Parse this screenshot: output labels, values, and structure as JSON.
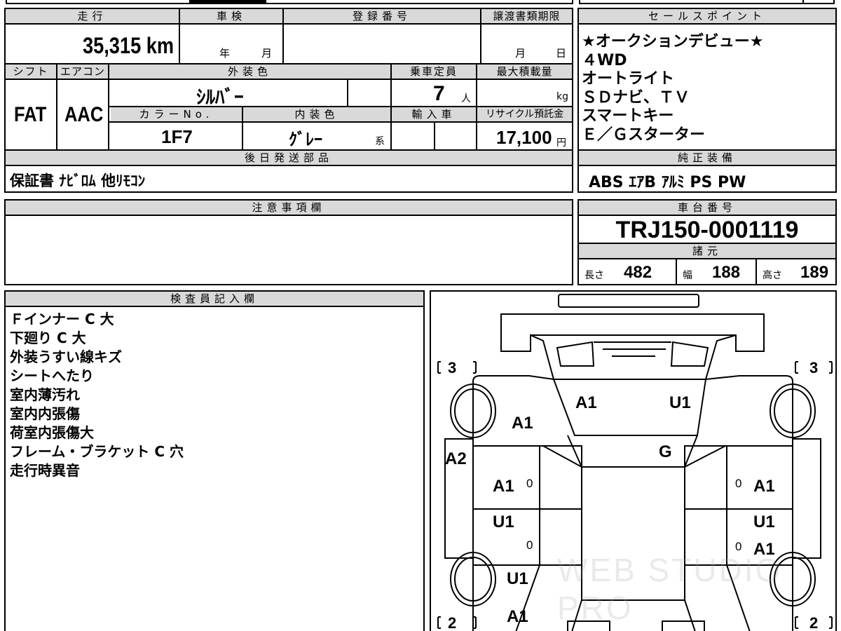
{
  "basic": {
    "mileage_label": "走行",
    "mileage_value": "35,315 km",
    "inspection_label": "車検",
    "inspection_year": "年",
    "inspection_month": "月",
    "registration_label": "登録番号",
    "transfer_deadline_label": "譲渡書類期限",
    "transfer_month": "月",
    "transfer_day": "日",
    "shift_label": "シフト",
    "shift_value": "FAT",
    "aircon_label": "エアコン",
    "aircon_value": "AAC",
    "exterior_color_label": "外装色",
    "exterior_color_value": "ｼﾙﾊﾞｰ",
    "capacity_label": "乗車定員",
    "capacity_value": "7",
    "capacity_unit": "人",
    "max_load_label": "最大積載量",
    "max_load_unit": "kg",
    "color_no_label": "カラーNo.",
    "color_no_value": "1F7",
    "interior_color_label": "内装色",
    "interior_color_value": "ｸﾞﾚｰ",
    "interior_color_suffix": "系",
    "import_label": "輸入車",
    "recycle_label": "リサイクル預託金",
    "recycle_value": "17,100",
    "recycle_unit": "円"
  },
  "later_parts": {
    "label": "後日発送部品",
    "value": "保証書 ﾅﾋﾞﾛﾑ 他ﾘﾓｺﾝ"
  },
  "sales_points": {
    "label": "セールスポイント",
    "items": [
      "★オークションデビュー★",
      "４WD",
      "オートライト",
      "ＳＤナビ、ＴＶ",
      "スマートキー",
      "Ｅ／Ｇスターター"
    ]
  },
  "factory_equipment": {
    "label": "純正装備",
    "value": "ABS ｴｱB ｱﾙﾐ PS PW"
  },
  "notes": {
    "label": "注意事項欄"
  },
  "chassis": {
    "label": "車台番号",
    "value": "TRJ150-0001119"
  },
  "specs": {
    "label": "諸元",
    "length_label": "長さ",
    "length_value": "482",
    "width_label": "幅",
    "width_value": "188",
    "height_label": "高さ",
    "height_value": "189"
  },
  "inspector": {
    "label": "検査員記入欄",
    "lines": [
      "Ｆインナー C 大",
      "下廻り C 大",
      "外装うすい線キズ",
      "シートへたり",
      "室内薄汚れ",
      "室内内張傷",
      "荷室内張傷大",
      "フレーム・ブラケット C 穴",
      "走行時異音"
    ]
  },
  "diagram": {
    "marks": [
      "A1",
      "U1",
      "A1",
      "A2",
      "G",
      "A1",
      "A1",
      "U1",
      "U1",
      "A1",
      "U1",
      "A1"
    ],
    "side_counts": [
      "3",
      "3",
      "2",
      "2"
    ],
    "zero": "0",
    "watermark": "WEB STUDIO PRO"
  }
}
